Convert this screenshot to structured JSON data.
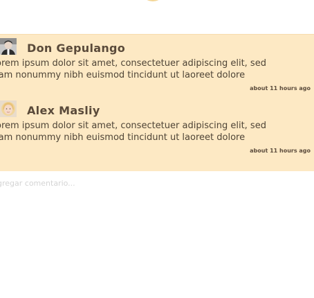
{
  "comments": [
    {
      "author": "Don Gepulango",
      "text_line1": "orem ipsum dolor sit amet, consectetuer adipiscing elit, sed",
      "text_line2": "iam nonummy nibh euismod tincidunt ut laoreet dolore",
      "time": "about 11 hours ago",
      "avatar_icon": "user-photo-icon"
    },
    {
      "author": "Alex Masliy",
      "text_line1": "orem ipsum dolor sit amet, consectetuer adipiscing elit, sed",
      "text_line2": "iam nonummy nibh euismod tincidunt ut laoreet dolore",
      "time": "about 11 hours ago",
      "avatar_icon": "user-photo-icon"
    }
  ],
  "add_comment": {
    "placeholder": "gregar comentario..."
  },
  "colors": {
    "panel_background": "#fde9c4",
    "author_text": "#5a4a3a",
    "body_text": "#4e4436",
    "placeholder_text": "#d4d4d4"
  }
}
